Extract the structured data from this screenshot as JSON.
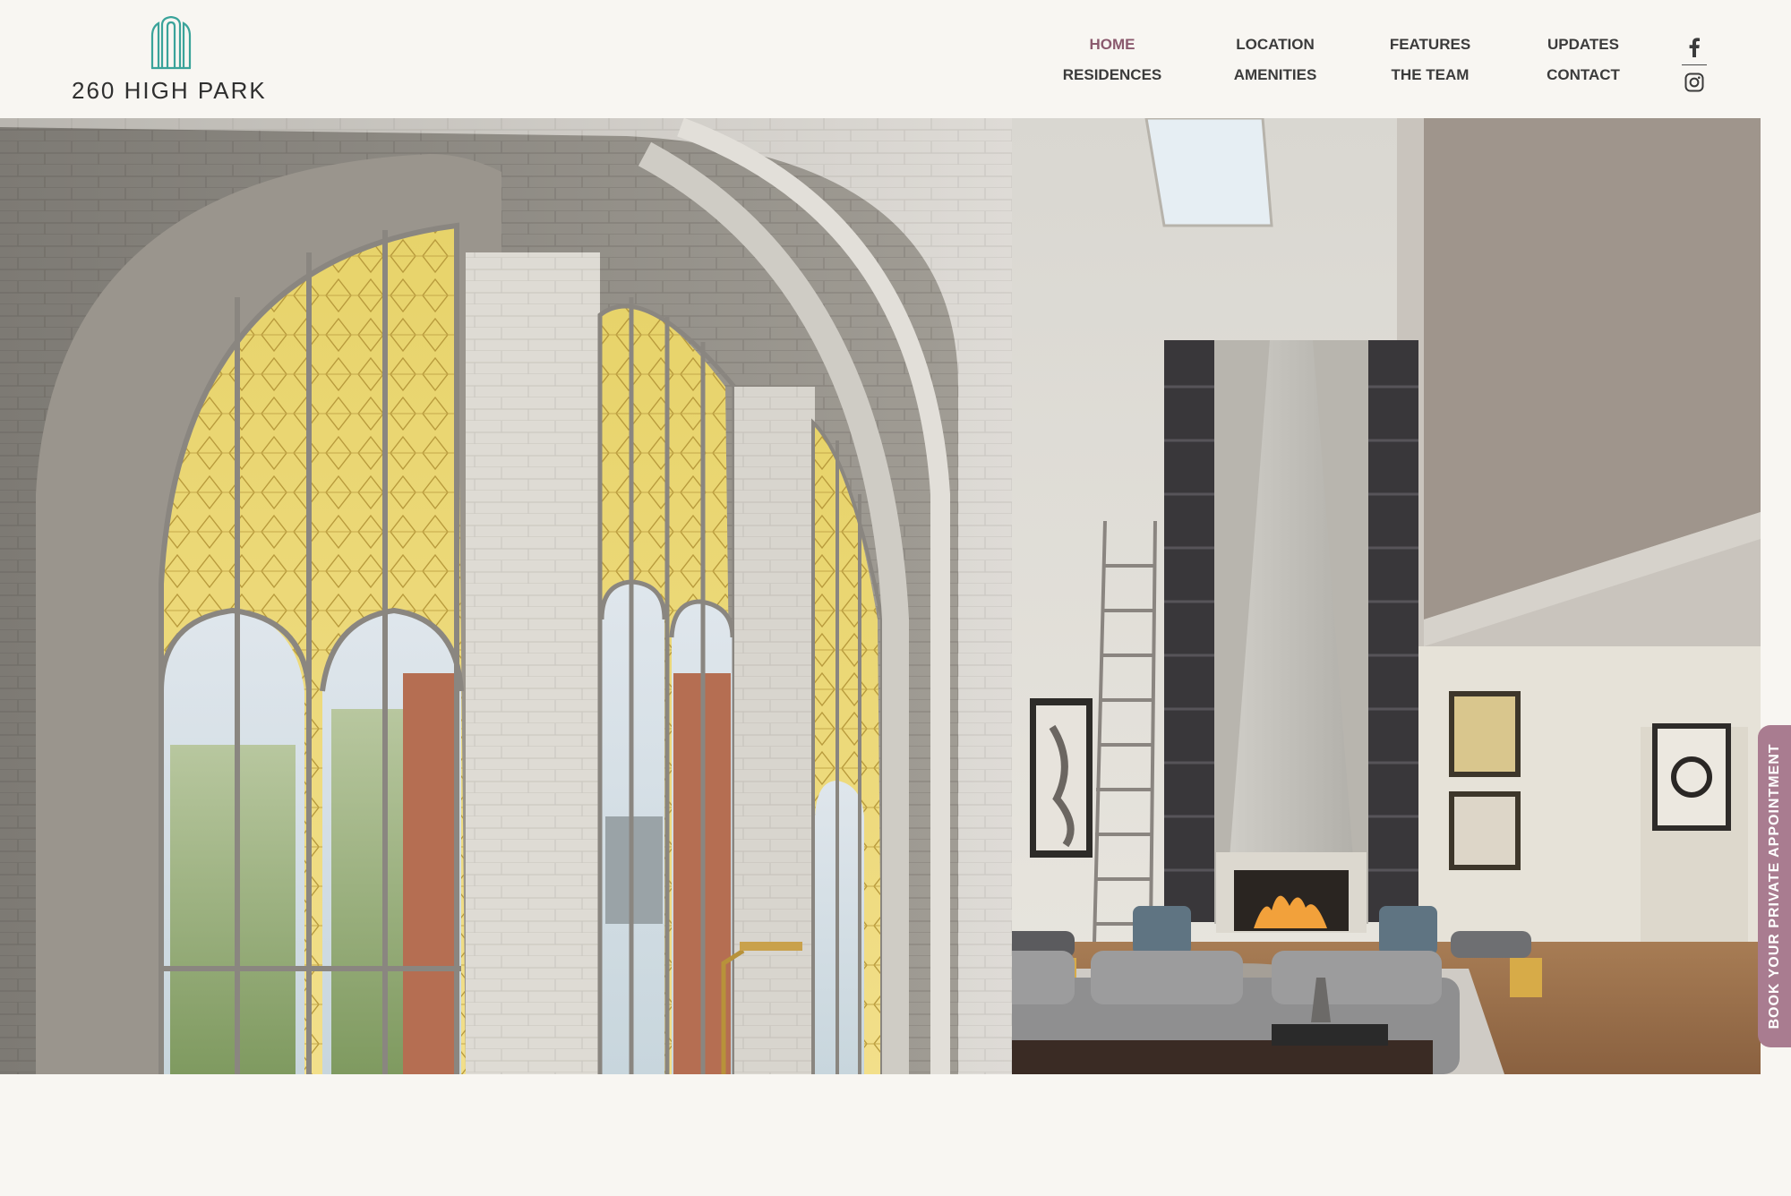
{
  "brand": {
    "name": "260 HIGH PARK",
    "logo_icon": "arched-building-logo-icon",
    "logo_color": "#3aa39a"
  },
  "nav": {
    "items": [
      {
        "label": "HOME",
        "active": true
      },
      {
        "label": "LOCATION",
        "active": false
      },
      {
        "label": "FEATURES",
        "active": false
      },
      {
        "label": "UPDATES",
        "active": false
      },
      {
        "label": "RESIDENCES",
        "active": false
      },
      {
        "label": "AMENITIES",
        "active": false
      },
      {
        "label": "THE TEAM",
        "active": false
      },
      {
        "label": "CONTACT",
        "active": false
      }
    ],
    "active_color": "#8b5a6e",
    "text_color": "#3b3b3b"
  },
  "social": {
    "items": [
      {
        "icon": "facebook-icon"
      },
      {
        "icon": "instagram-icon"
      }
    ]
  },
  "hero": {
    "image": "interior-loft-rendering",
    "alt": ""
  },
  "cta": {
    "label": "BOOK YOUR PRIVATE APPOINTMENT",
    "color": "#a97c90"
  }
}
